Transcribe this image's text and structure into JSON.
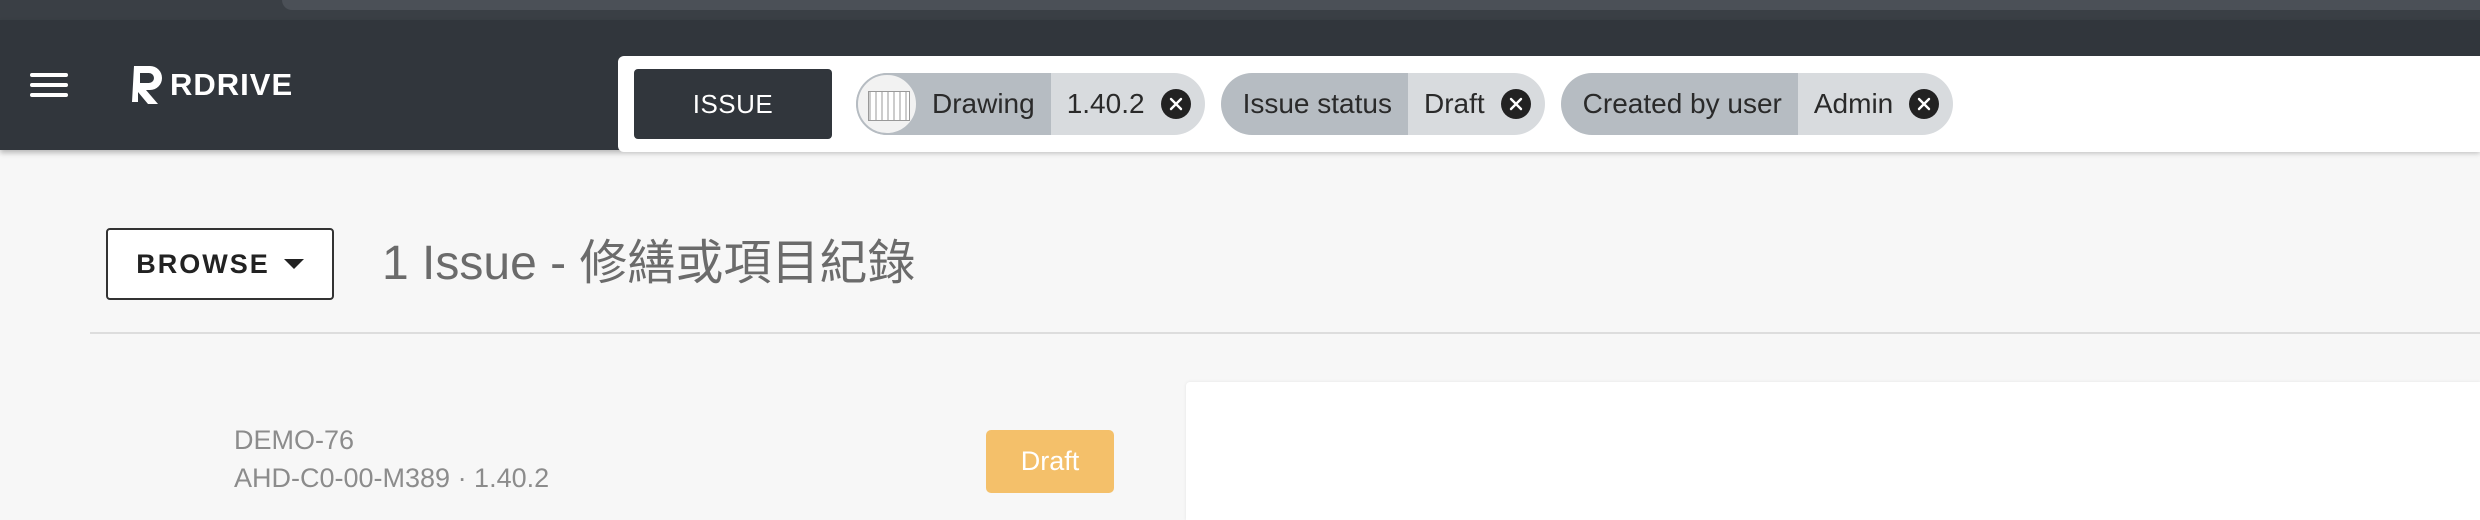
{
  "app": {
    "logo_text": "RDRIVE"
  },
  "search": {
    "type_button": "ISSUE",
    "chips": [
      {
        "key": "Drawing",
        "value": "1.40.2",
        "has_thumbnail": true
      },
      {
        "key": "Issue status",
        "value": "Draft",
        "has_thumbnail": false
      },
      {
        "key": "Created by user",
        "value": "Admin",
        "has_thumbnail": false
      }
    ]
  },
  "toolbar": {
    "browse_label": "BROWSE"
  },
  "page": {
    "title": "1 Issue - 修繕或項目紀錄"
  },
  "issues": [
    {
      "id": "DEMO-76",
      "subtitle": "AHD-C0-00-M389 · 1.40.2",
      "status": "Draft"
    }
  ],
  "colors": {
    "header_bg": "#31363c",
    "draft_badge": "#f4c06a",
    "chip_key_bg": "#b6bcc2",
    "chip_value_bg": "#d8dbde"
  },
  "icons": {
    "menu": "hamburger-icon",
    "remove_chip": "close-circle-icon",
    "browse": "caret-down-icon"
  }
}
